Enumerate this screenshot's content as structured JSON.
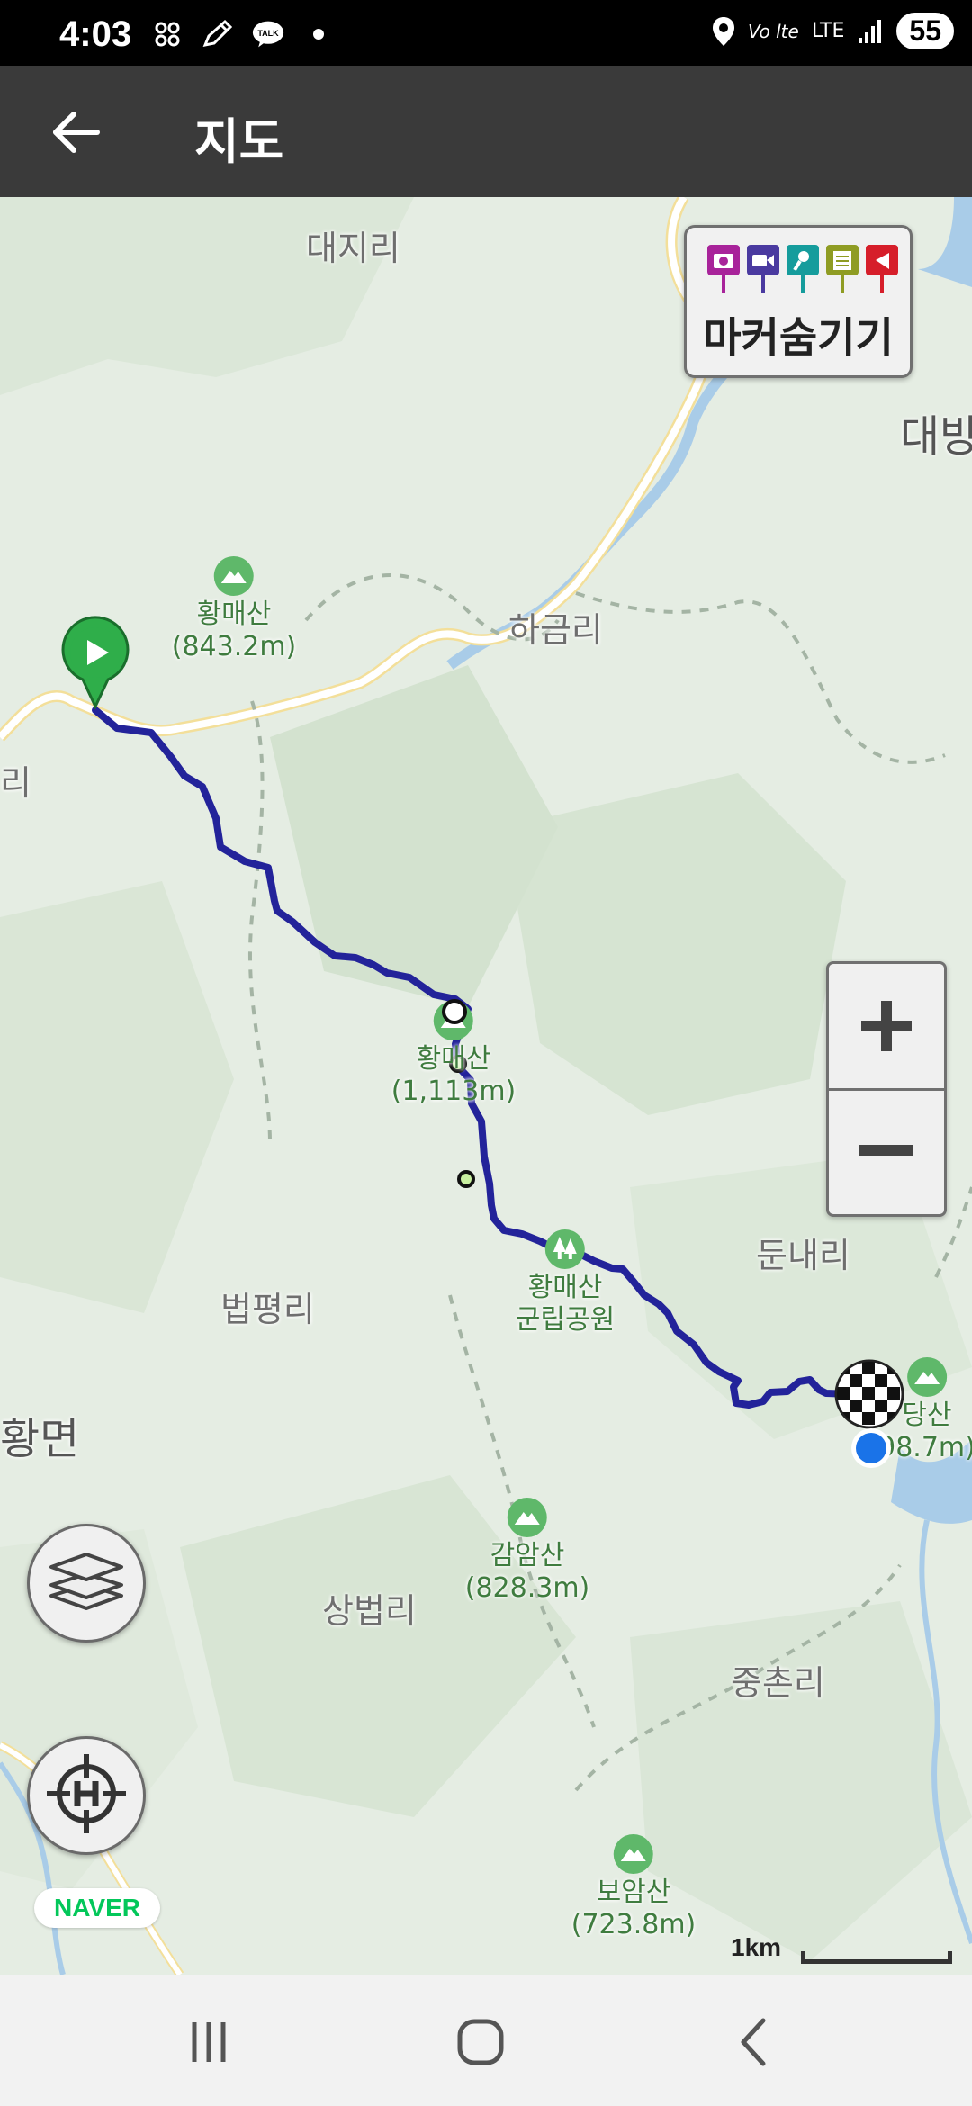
{
  "status_bar": {
    "time": "4:03",
    "notification_icons": [
      "dots-grid-icon",
      "pen-icon",
      "talk-icon",
      "dot-icon"
    ],
    "talk_label": "TALK",
    "volte": "Vo lte",
    "network": "LTE",
    "battery": "55"
  },
  "app_bar": {
    "title": "지도"
  },
  "map": {
    "places": {
      "daeji": "대지리",
      "daebang": "대방",
      "hageum": "하금리",
      "ri_left": "리",
      "beobpyeong": "법평리",
      "dunnae": "둔내리",
      "hwangmyeon": "황면",
      "sangbeob": "상법리",
      "jungchon": "중촌리"
    },
    "pois": {
      "hwangmae_843": {
        "name": "황매산",
        "sub": "(843.2m)",
        "icon": "mountain-icon"
      },
      "hwangmae_1113": {
        "name": "황매산",
        "sub": "(1,113m)",
        "icon": "mountain-icon"
      },
      "hwangmae_park": {
        "name": "황매산",
        "sub": "군립공원",
        "icon": "park-tree-icon"
      },
      "dangsan": {
        "name": "당산",
        "sub": "98.7m)",
        "icon": "mountain-icon"
      },
      "gamam": {
        "name": "감암산",
        "sub": "(828.3m)",
        "icon": "mountain-icon"
      },
      "boam": {
        "name": "보암산",
        "sub": "(723.8m)",
        "icon": "mountain-icon"
      }
    },
    "route": {
      "start_icon": "start-play-marker-icon",
      "finish_icon": "checkered-flag-finish-icon",
      "current_location_icon": "current-location-dot-icon",
      "color": "#23239a"
    },
    "marker_toggle": {
      "label": "마커숨기기",
      "pin_icons": [
        "camera-icon",
        "video-icon",
        "microphone-icon",
        "notepad-icon",
        "flag-icon"
      ],
      "pin_colors": [
        "#a8239a",
        "#4a3aa0",
        "#159c9c",
        "#8f9c23",
        "#d61e2a"
      ]
    },
    "zoom": {
      "in_label": "+",
      "out_label": "−"
    },
    "layers_icon": "layers-icon",
    "home_icon": "crosshair-h-icon",
    "provider": "NAVER",
    "scale_label": "1km"
  },
  "nav_bar": {
    "recents_icon": "recents-icon",
    "home_icon": "home-circle-icon",
    "back_icon": "back-chevron-icon"
  }
}
